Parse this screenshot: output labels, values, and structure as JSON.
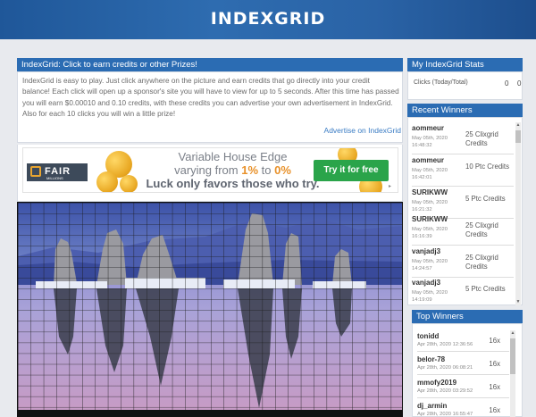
{
  "header": {
    "title": "INDEXGRID"
  },
  "main": {
    "panel_title": "IndexGrid: Click to earn credits or other Prizes!",
    "description": "IndexGrid is easy to play. Just click anywhere on the picture and earn credits that go directly into your credit balance! Each click will open up a sponsor's site you will have to view for up to 5 seconds. After this time has passed you will earn $0.00010 and 0.10 credits, with these credits you can advertise your own advertisement in IndexGrid. Also for each 10 clicks you will win a little prize!",
    "advertise_link": "Advertise on IndexGrid"
  },
  "banner": {
    "logo": "FAIR",
    "logo_sub": "MILLIONS",
    "line1": "Variable House Edge",
    "line2_prefix": "varying from ",
    "line2_a": "1%",
    "line2_mid": " to ",
    "line2_b": "0%",
    "line3": "Luck only favors those who try.",
    "cta": "Try it for free"
  },
  "stats": {
    "title": "My IndexGrid Stats",
    "label": "Clicks (Today/Total)",
    "today": "0",
    "total": "0"
  },
  "recent": {
    "title": "Recent Winners",
    "items": [
      {
        "name": "aommeur",
        "date": "May 05th, 2020 16:48:32",
        "amount": "25 Clixgrid Credits"
      },
      {
        "name": "aommeur",
        "date": "May 05th, 2020 16:42:01",
        "amount": "10 Ptc Credits"
      },
      {
        "name": "SURIKWW",
        "date": "May 05th, 2020 16:21:32",
        "amount": "5 Ptc Credits"
      },
      {
        "name": "SURIKWW",
        "date": "May 05th, 2020 16:16:39",
        "amount": "25 Clixgrid Credits"
      },
      {
        "name": "vanjadj3",
        "date": "May 05th, 2020 14:24:57",
        "amount": "25 Clixgrid Credits"
      },
      {
        "name": "vanjadj3",
        "date": "May 05th, 2020 14:19:09",
        "amount": "5 Ptc Credits"
      }
    ]
  },
  "top": {
    "title": "Top Winners",
    "items": [
      {
        "name": "tonidd",
        "date": "Apr 28th, 2020 12:36:56",
        "amount": "16x"
      },
      {
        "name": "belor-78",
        "date": "Apr 28th, 2020 06:08:21",
        "amount": "16x"
      },
      {
        "name": "mmofy2019",
        "date": "Apr 28th, 2020 03:29:52",
        "amount": "16x"
      },
      {
        "name": "dj_armin",
        "date": "Apr 28th, 2020 16:55:47",
        "amount": "16x"
      }
    ]
  },
  "colors": {
    "header": "#2a63a6",
    "panel": "#2b6cb3",
    "link": "#3a7cc4",
    "cta": "#2aa44a"
  }
}
